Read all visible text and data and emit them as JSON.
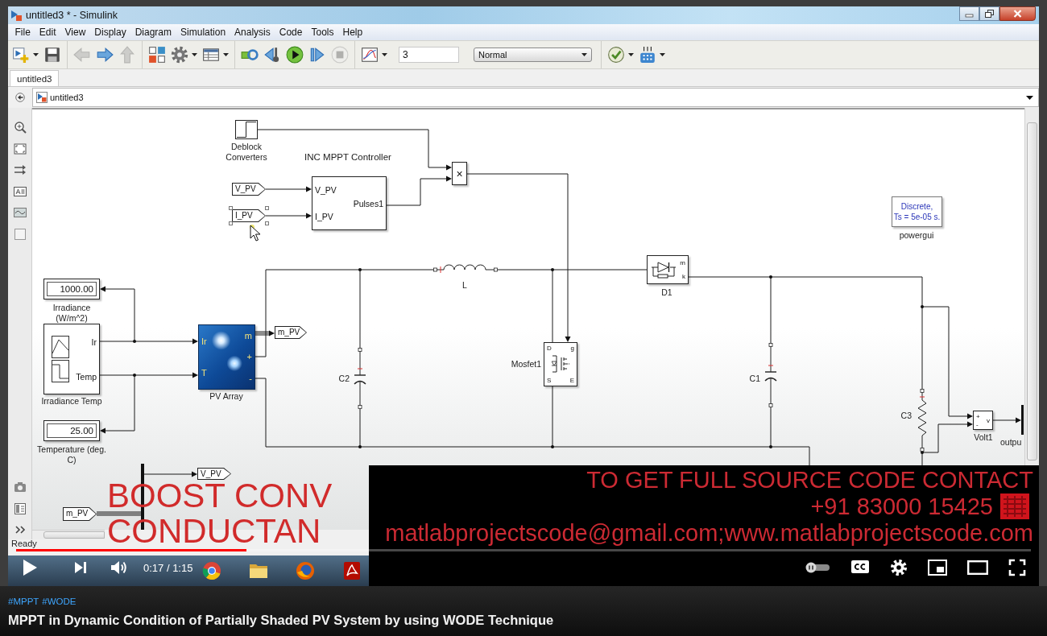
{
  "player": {
    "app_window": {
      "title": "untitled3 * - Simulink",
      "menu": [
        "File",
        "Edit",
        "View",
        "Display",
        "Diagram",
        "Simulation",
        "Analysis",
        "Code",
        "Tools",
        "Help"
      ],
      "toolbar": [
        {
          "kind": "button",
          "dropdown": true,
          "disabled": false
        },
        {
          "kind": "button",
          "dropdown": false,
          "disabled": false
        },
        {
          "kind": "separator"
        },
        {
          "kind": "button",
          "dropdown": false,
          "disabled": true
        },
        {
          "kind": "button",
          "dropdown": false,
          "disabled": false
        },
        {
          "kind": "button",
          "dropdown": false,
          "disabled": true
        },
        {
          "kind": "separator"
        },
        {
          "kind": "button",
          "dropdown": false,
          "disabled": false
        },
        {
          "kind": "button",
          "dropdown": true,
          "disabled": false
        },
        {
          "kind": "button",
          "dropdown": true,
          "disabled": false
        },
        {
          "kind": "separator"
        },
        {
          "kind": "button",
          "dropdown": false,
          "disabled": false
        },
        {
          "kind": "button",
          "dropdown": false,
          "disabled": false
        },
        {
          "kind": "button",
          "dropdown": false,
          "disabled": false
        },
        {
          "kind": "button",
          "dropdown": false,
          "disabled": false
        },
        {
          "kind": "button",
          "dropdown": false,
          "disabled": true
        },
        {
          "kind": "separator"
        },
        {
          "kind": "button",
          "dropdown": true,
          "disabled": false
        },
        {
          "kind": "field",
          "value": "3"
        },
        {
          "kind": "select",
          "value": "Normal"
        },
        {
          "kind": "separator"
        },
        {
          "kind": "button",
          "dropdown": true,
          "disabled": false
        },
        {
          "kind": "button",
          "dropdown": true,
          "disabled": false
        }
      ],
      "tabs": [
        {
          "label": "untitled3",
          "selected": true
        }
      ],
      "breadcrumb": "untitled3",
      "diagram": {
        "blocks": [
          {
            "kind": "step",
            "label": "Deblock Converters",
            "selected": false
          },
          {
            "kind": "tag",
            "label": "V_PV",
            "selected": false
          },
          {
            "kind": "tag",
            "label": "I_PV",
            "selected": true
          },
          {
            "kind": "subsystem",
            "title": "INC MPPT Controller",
            "inputs": [
              "V_PV",
              "I_PV"
            ],
            "outputs": [
              "Pulses1"
            ],
            "selected": false
          },
          {
            "kind": "product",
            "symbol": "×",
            "selected": false
          },
          {
            "kind": "powergui",
            "lines": [
              "Discrete,",
              "Ts = 5e-05 s."
            ],
            "label": "powergui",
            "selected": false
          },
          {
            "kind": "display",
            "value": "1000.00",
            "label": "Irradiance (W/m^2)",
            "selected": false
          },
          {
            "kind": "inductor",
            "label": "L",
            "selected": false
          },
          {
            "kind": "diode",
            "ports": [
              "m",
              "k"
            ],
            "label": "D1",
            "selected": false
          },
          {
            "kind": "signal_builder",
            "outputs": [
              "Ir",
              "Temp"
            ],
            "label": "Irradiance Temp",
            "selected": false
          },
          {
            "kind": "display",
            "value": "25.00",
            "label": "Temperature (deg. C)",
            "selected": false
          },
          {
            "kind": "pv_array",
            "inputs": [
              "Ir",
              "T"
            ],
            "outputs": [
              "m",
              "+",
              "-"
            ],
            "label": "PV Array",
            "selected": false
          },
          {
            "kind": "tag",
            "label": "m_PV",
            "selected": false
          },
          {
            "kind": "capacitor",
            "label": "C2",
            "selected": false
          },
          {
            "kind": "mosfet",
            "ports": [
              "D",
              "g",
              "S",
              "E"
            ],
            "label": "Mosfet1",
            "selected": false
          },
          {
            "kind": "capacitor",
            "label": "C1",
            "selected": false
          },
          {
            "kind": "resistor",
            "label": "C3",
            "selected": false
          },
          {
            "kind": "voltmeter",
            "ports": [
              "+",
              "-",
              "v"
            ],
            "label": "Volt1",
            "selected": false
          },
          {
            "kind": "output",
            "label": "outpu",
            "selected": false
          },
          {
            "kind": "tag",
            "label": "V_PV",
            "selected": false
          },
          {
            "kind": "tag",
            "label": "m_PV",
            "selected": false
          }
        ]
      },
      "status": "Ready"
    },
    "caption": [
      "BOOST CONV",
      "CONDUCTAN"
    ],
    "promo": [
      "TO GET FULL SOURCE CODE CONTACT",
      "+91 83000 15425",
      "matlabprojectscode@gmail.com;www.matlabprojectscode.com"
    ],
    "controls": {
      "progress": {
        "level": 0.227
      },
      "time": "0:17 / 1:15",
      "autoplay": false,
      "captions": false
    }
  },
  "hashtags": [
    "#MPPT",
    "#WODE"
  ],
  "title": "MPPT in Dynamic Condition of Partially Shaded PV System by using WODE Technique"
}
